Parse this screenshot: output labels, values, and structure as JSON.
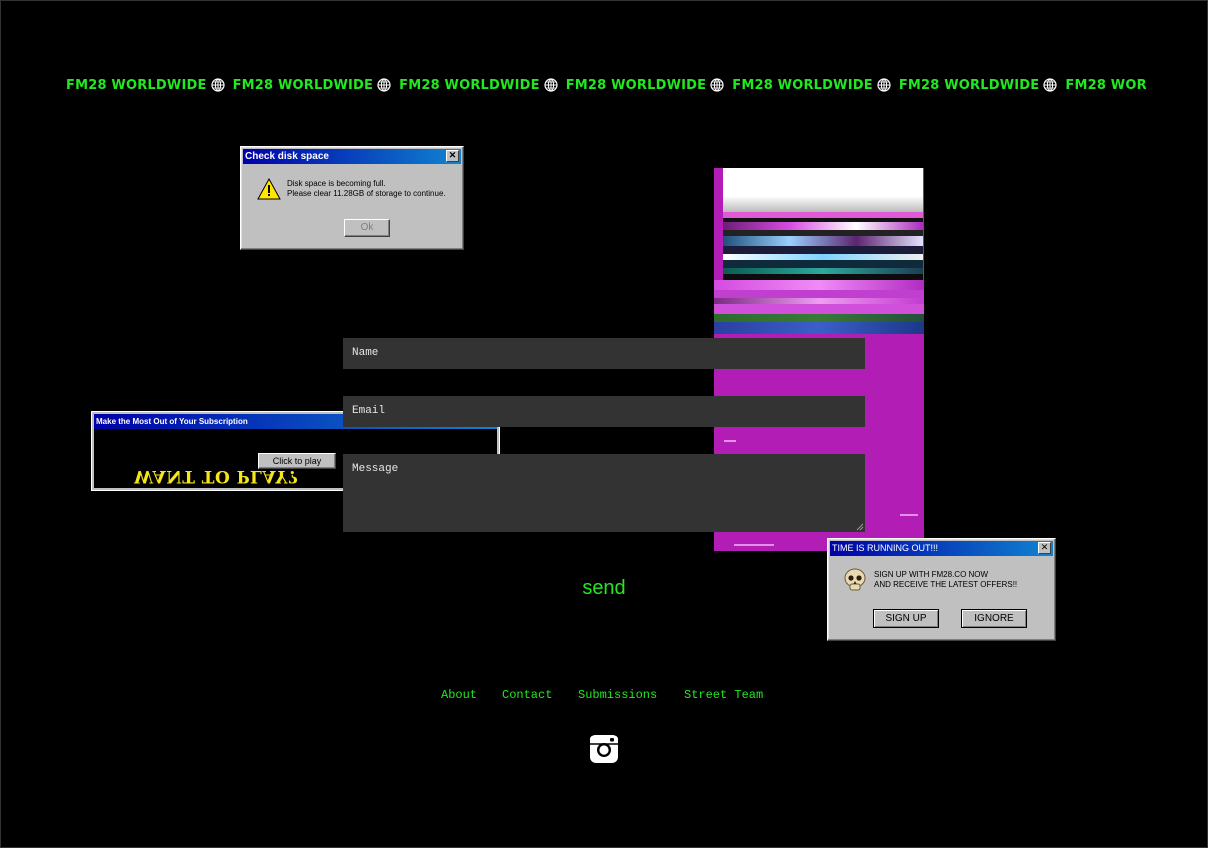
{
  "marquee": {
    "text": "FM28 WORLDWIDE",
    "repeat_count": 7,
    "color": "#22e822",
    "icon": "globe-icon"
  },
  "disk_dialog": {
    "title": "Check disk space",
    "line1": "Disk space is becoming full.",
    "line2": "Please clear 11.28GB of storage to continue.",
    "ok_label": "Ok",
    "icon": "warning-icon"
  },
  "subscription_popup": {
    "title": "Make the Most Out of Your Subscription",
    "button_label": "Click to play",
    "banner_text": "WANT TO PLAY?"
  },
  "time_popup": {
    "title": "TIME IS RUNNING OUT!!!",
    "line1": "SIGN UP WITH FM28.CO NOW",
    "line2": "AND RECEIVE THE LATEST OFFERS!!",
    "signup_label": "SIGN UP",
    "ignore_label": "IGNORE",
    "icon": "skull-icon"
  },
  "form": {
    "name_placeholder": "Name",
    "email_placeholder": "Email",
    "message_placeholder": "Message",
    "send_label": "send"
  },
  "nav": {
    "about": "About",
    "contact": "Contact",
    "submissions": "Submissions",
    "street_team": "Street Team"
  },
  "social": {
    "icon": "instagram-icon"
  }
}
